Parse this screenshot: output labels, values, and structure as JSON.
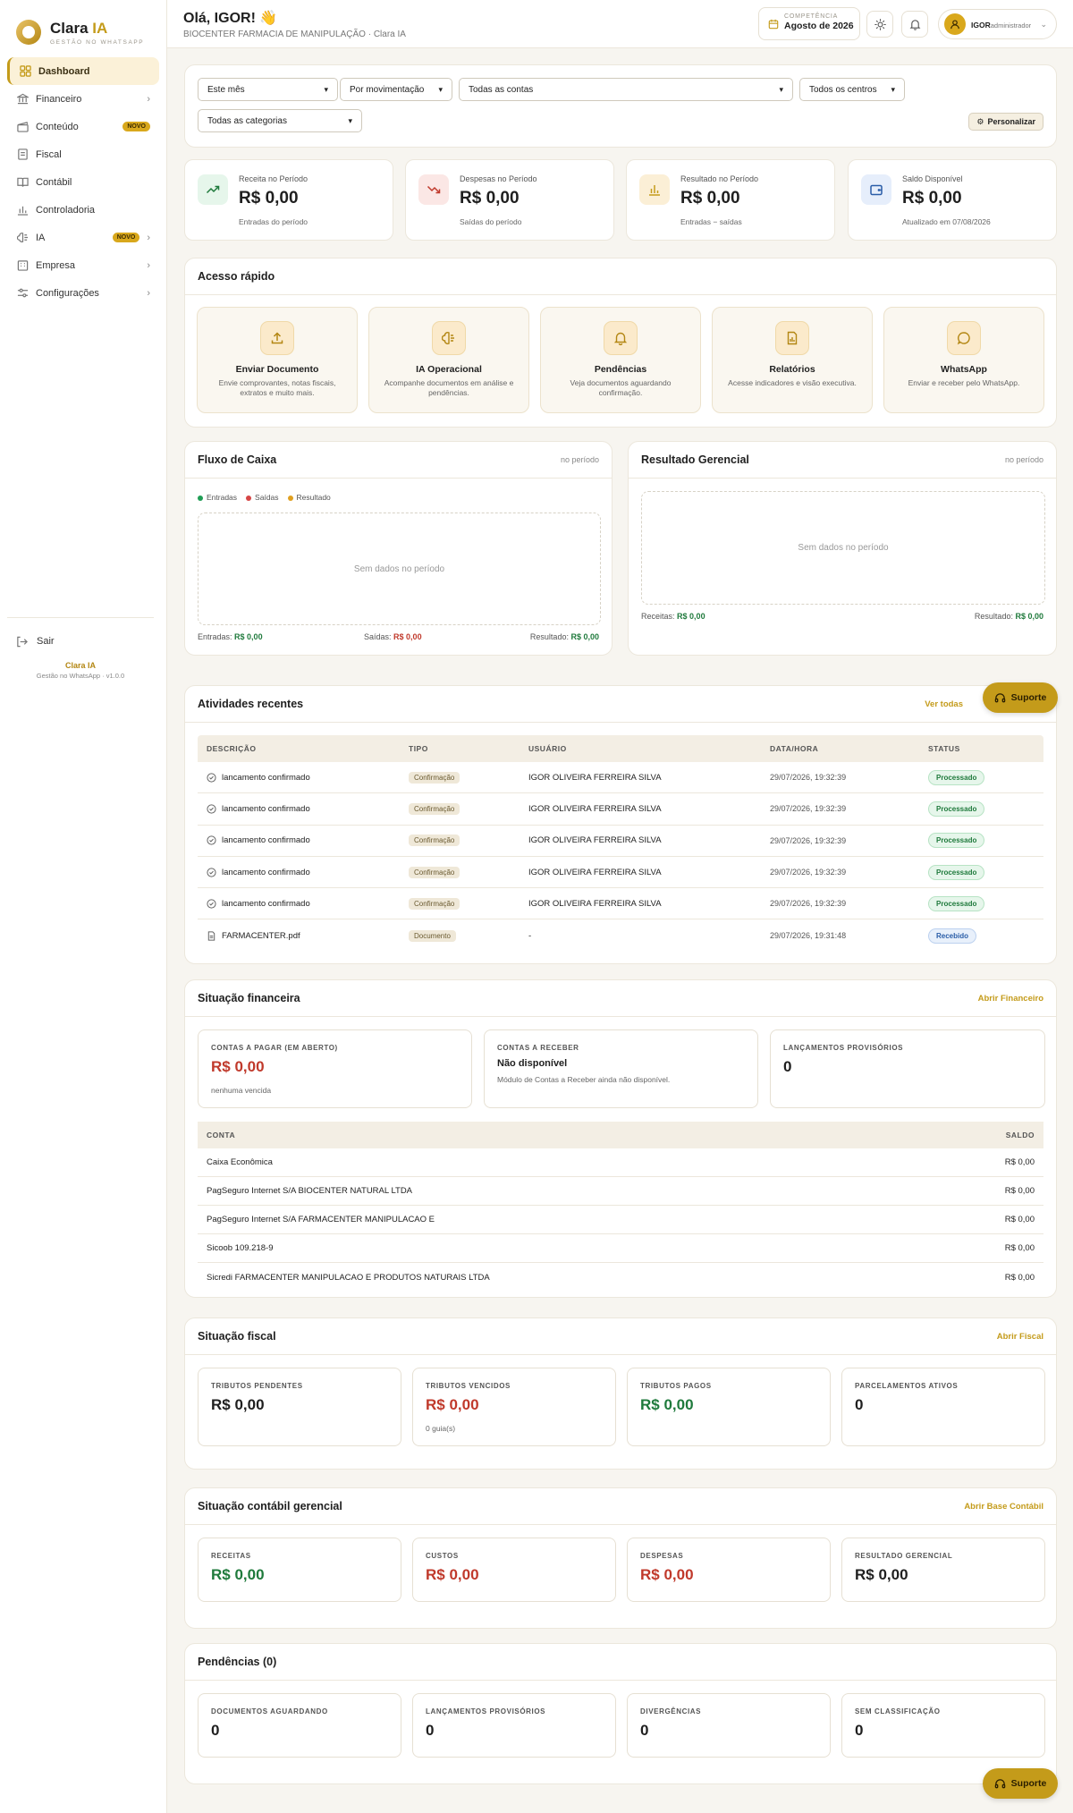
{
  "brand": {
    "name": "Clara",
    "name_ia": "IA",
    "tagline": "GESTÃO NO WHATSAPP"
  },
  "sidebar": {
    "items": [
      {
        "label": "Dashboard"
      },
      {
        "label": "Financeiro"
      },
      {
        "label": "Conteúdo",
        "badge": "NOVO"
      },
      {
        "label": "Fiscal"
      },
      {
        "label": "Contábil"
      },
      {
        "label": "Controladoria"
      },
      {
        "label": "IA",
        "badge": "NOVO"
      },
      {
        "label": "Empresa"
      },
      {
        "label": "Configurações"
      }
    ],
    "logout": "Sair",
    "footer_brand": "Clara IA",
    "footer_version": "Gestão no WhatsApp · v1.0.0"
  },
  "header": {
    "greeting": "Olá, IGOR! 👋",
    "company": "BIOCENTER FARMACIA DE MANIPULAÇÃO · Clara IA",
    "competencia_label": "COMPETÊNCIA",
    "competencia_value": "Agosto de 2026",
    "user_name": "IGOR",
    "user_role": "administrador"
  },
  "filters": {
    "period": "Este mês",
    "mode": "Por movimentação",
    "accounts": "Todas as contas",
    "centers": "Todos os centros",
    "categories": "Todas as categorias",
    "customize": "Personalizar"
  },
  "kpis": [
    {
      "label": "Receita no Período",
      "value": "R$ 0,00",
      "sub": "Entradas do período"
    },
    {
      "label": "Despesas no Período",
      "value": "R$ 0,00",
      "sub": "Saídas do período"
    },
    {
      "label": "Resultado no Período",
      "value": "R$ 0,00",
      "sub": "Entradas − saídas"
    },
    {
      "label": "Saldo Disponível",
      "value": "R$ 0,00",
      "sub": "Atualizado em 07/08/2026"
    }
  ],
  "quick_access": {
    "title": "Acesso rápido",
    "items": [
      {
        "title": "Enviar Documento",
        "desc": "Envie comprovantes, notas fiscais, extratos e muito mais."
      },
      {
        "title": "IA Operacional",
        "desc": "Acompanhe documentos em análise e pendências."
      },
      {
        "title": "Pendências",
        "desc": "Veja documentos aguardando confirmação."
      },
      {
        "title": "Relatórios",
        "desc": "Acesse indicadores e visão executiva."
      },
      {
        "title": "WhatsApp",
        "desc": "Enviar e receber pelo WhatsApp."
      }
    ]
  },
  "cashflow": {
    "title": "Fluxo de Caixa",
    "period": "no período",
    "legend": [
      "Entradas",
      "Saídas",
      "Resultado"
    ],
    "empty": "Sem dados no período",
    "in_label": "Entradas:",
    "in_value": "R$ 0,00",
    "out_label": "Saídas:",
    "out_value": "R$ 0,00",
    "res_label": "Resultado:",
    "res_value": "R$ 0,00"
  },
  "managerial": {
    "title": "Resultado Gerencial",
    "period": "no período",
    "empty": "Sem dados no período",
    "rev_label": "Receitas:",
    "rev_value": "R$ 0,00",
    "res_label": "Resultado:",
    "res_value": "R$ 0,00"
  },
  "activities": {
    "title": "Atividades recentes",
    "link": "Ver todas",
    "columns": [
      "DESCRIÇÃO",
      "TIPO",
      "USUÁRIO",
      "DATA/HORA",
      "STATUS"
    ],
    "rows": [
      {
        "desc": "lancamento confirmado",
        "type": "Confirmação",
        "user": "IGOR OLIVEIRA FERREIRA SILVA",
        "date": "29/07/2026, 19:32:39",
        "status": "Processado"
      },
      {
        "desc": "lancamento confirmado",
        "type": "Confirmação",
        "user": "IGOR OLIVEIRA FERREIRA SILVA",
        "date": "29/07/2026, 19:32:39",
        "status": "Processado"
      },
      {
        "desc": "lancamento confirmado",
        "type": "Confirmação",
        "user": "IGOR OLIVEIRA FERREIRA SILVA",
        "date": "29/07/2026, 19:32:39",
        "status": "Processado"
      },
      {
        "desc": "lancamento confirmado",
        "type": "Confirmação",
        "user": "IGOR OLIVEIRA FERREIRA SILVA",
        "date": "29/07/2026, 19:32:39",
        "status": "Processado"
      },
      {
        "desc": "lancamento confirmado",
        "type": "Confirmação",
        "user": "IGOR OLIVEIRA FERREIRA SILVA",
        "date": "29/07/2026, 19:32:39",
        "status": "Processado"
      },
      {
        "desc": "FARMACENTER.pdf",
        "type": "Documento",
        "user": "-",
        "date": "29/07/2026, 19:31:48",
        "status": "Recebido"
      }
    ]
  },
  "financial": {
    "title": "Situação financeira",
    "link": "Abrir Financeiro",
    "payable_label": "CONTAS A PAGAR (EM ABERTO)",
    "payable_value": "R$ 0,00",
    "payable_sub": "nenhuma vencida",
    "receivable_label": "CONTAS A RECEBER",
    "receivable_value": "Não disponível",
    "receivable_sub": "Módulo de Contas a Receber ainda não disponível.",
    "provisional_label": "LANÇAMENTOS PROVISÓRIOS",
    "provisional_value": "0",
    "accounts_header": [
      "CONTA",
      "SALDO"
    ],
    "accounts": [
      {
        "name": "Caixa Econômica",
        "balance": "R$ 0,00"
      },
      {
        "name": "PagSeguro Internet S/A BIOCENTER NATURAL LTDA",
        "balance": "R$ 0,00"
      },
      {
        "name": "PagSeguro Internet S/A FARMACENTER MANIPULACAO E",
        "balance": "R$ 0,00"
      },
      {
        "name": "Sicoob 109.218-9",
        "balance": "R$ 0,00"
      },
      {
        "name": "Sicredi FARMACENTER MANIPULACAO E PRODUTOS NATURAIS LTDA",
        "balance": "R$ 0,00"
      }
    ]
  },
  "fiscal": {
    "title": "Situação fiscal",
    "link": "Abrir Fiscal",
    "boxes": [
      {
        "label": "TRIBUTOS PENDENTES",
        "value": "R$ 0,00",
        "sub": ""
      },
      {
        "label": "TRIBUTOS VENCIDOS",
        "value": "R$ 0,00",
        "sub": "0 guia(s)"
      },
      {
        "label": "TRIBUTOS PAGOS",
        "value": "R$ 0,00",
        "sub": ""
      },
      {
        "label": "PARCELAMENTOS ATIVOS",
        "value": "0",
        "sub": ""
      }
    ]
  },
  "accounting": {
    "title": "Situação contábil gerencial",
    "link": "Abrir Base Contábil",
    "boxes": [
      {
        "label": "RECEITAS",
        "value": "R$ 0,00"
      },
      {
        "label": "CUSTOS",
        "value": "R$ 0,00"
      },
      {
        "label": "DESPESAS",
        "value": "R$ 0,00"
      },
      {
        "label": "RESULTADO GERENCIAL",
        "value": "R$ 0,00"
      }
    ]
  },
  "pending": {
    "title": "Pendências (0)",
    "boxes": [
      {
        "label": "DOCUMENTOS AGUARDANDO",
        "value": "0"
      },
      {
        "label": "LANÇAMENTOS PROVISÓRIOS",
        "value": "0"
      },
      {
        "label": "DIVERGÊNCIAS",
        "value": "0"
      },
      {
        "label": "SEM CLASSIFICAÇÃO",
        "value": "0"
      }
    ]
  },
  "support_label": "Suporte",
  "colors": {
    "accent": "#c49b1a",
    "positive": "#1f7a3c",
    "negative": "#c0392b",
    "entradas": "#1f9d55",
    "saidas": "#d64545",
    "resultado": "#e0a020"
  }
}
